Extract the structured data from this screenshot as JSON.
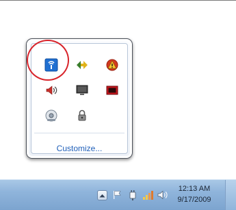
{
  "tray_popup": {
    "icons": [
      {
        "name": "network-adapter-icon"
      },
      {
        "name": "sync-arrows-icon"
      },
      {
        "name": "alert-shield-icon"
      },
      {
        "name": "speaker-icon"
      },
      {
        "name": "monitor-icon"
      },
      {
        "name": "red-screen-icon"
      },
      {
        "name": "disk-drive-icon"
      },
      {
        "name": "lock-icon"
      }
    ],
    "customize_label": "Customize..."
  },
  "taskbar": {
    "clock_time": "12:13 AM",
    "clock_date": "9/17/2009",
    "tray_icons": [
      "show-hidden-icons-icon",
      "action-center-flag-icon",
      "power-plug-icon",
      "signal-bars-icon",
      "volume-icon"
    ]
  },
  "colors": {
    "highlight_circle": "#d8232a",
    "taskbar": "#8fb4db",
    "link": "#1e5eb8"
  }
}
